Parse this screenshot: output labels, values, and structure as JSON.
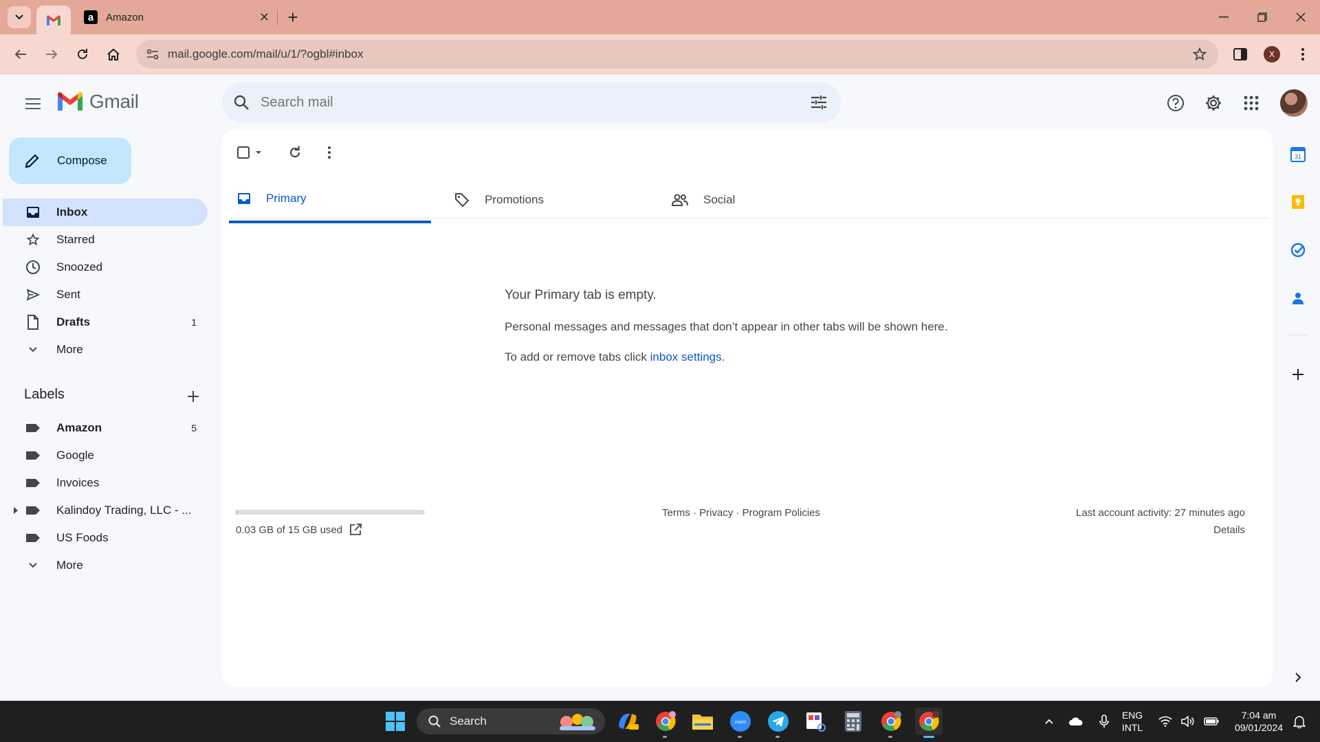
{
  "browser": {
    "tabs": [
      {
        "title": "",
        "favicon": "gmail-icon",
        "active": true
      },
      {
        "title": "Amazon",
        "favicon": "amazon-icon",
        "active": false
      }
    ],
    "url": "mail.google.com/mail/u/1/?ogbl#inbox",
    "profile_initial": "X"
  },
  "gmail": {
    "logo_text": "Gmail",
    "search_placeholder": "Search mail",
    "compose_label": "Compose",
    "nav": [
      {
        "label": "Inbox",
        "count": "",
        "icon": "inbox-icon",
        "active": true,
        "bold": true
      },
      {
        "label": "Starred",
        "count": "",
        "icon": "star-icon"
      },
      {
        "label": "Snoozed",
        "count": "",
        "icon": "clock-icon"
      },
      {
        "label": "Sent",
        "count": "",
        "icon": "send-icon"
      },
      {
        "label": "Drafts",
        "count": "1",
        "icon": "draft-icon",
        "bold": true
      },
      {
        "label": "More",
        "count": "",
        "icon": "chevron-down-icon"
      }
    ],
    "labels_heading": "Labels",
    "labels": [
      {
        "label": "Amazon",
        "count": "5",
        "bold": true
      },
      {
        "label": "Google",
        "count": ""
      },
      {
        "label": "Invoices",
        "count": ""
      },
      {
        "label": "Kalindoy Trading, LLC - ...",
        "count": "",
        "has_children": true
      },
      {
        "label": "US Foods",
        "count": ""
      }
    ],
    "labels_more": "More",
    "category_tabs": [
      {
        "label": "Primary",
        "icon": "inbox-icon",
        "active": true
      },
      {
        "label": "Promotions",
        "icon": "tag-icon"
      },
      {
        "label": "Social",
        "icon": "people-icon"
      }
    ],
    "empty_state": {
      "title": "Your Primary tab is empty.",
      "message": "Personal messages and messages that don’t appear in other tabs will be shown here.",
      "settings_prefix": "To add or remove tabs click ",
      "settings_link": "inbox settings",
      "settings_suffix": "."
    },
    "footer": {
      "storage": "0.03 GB of 15 GB used",
      "storage_fraction": 0.002,
      "links": "Terms · Privacy · Program Policies",
      "activity": "Last account activity: 27 minutes ago",
      "details": "Details"
    }
  },
  "taskbar": {
    "search_label": "Search",
    "lang_line1": "ENG",
    "lang_line2": "INTL",
    "time": "7:04 am",
    "date": "09/01/2024"
  },
  "colors": {
    "accent": "#0b57d0",
    "compose_bg": "#c2e7ff",
    "active_nav": "#d3e3fd",
    "tabbar": "#e3a898"
  }
}
